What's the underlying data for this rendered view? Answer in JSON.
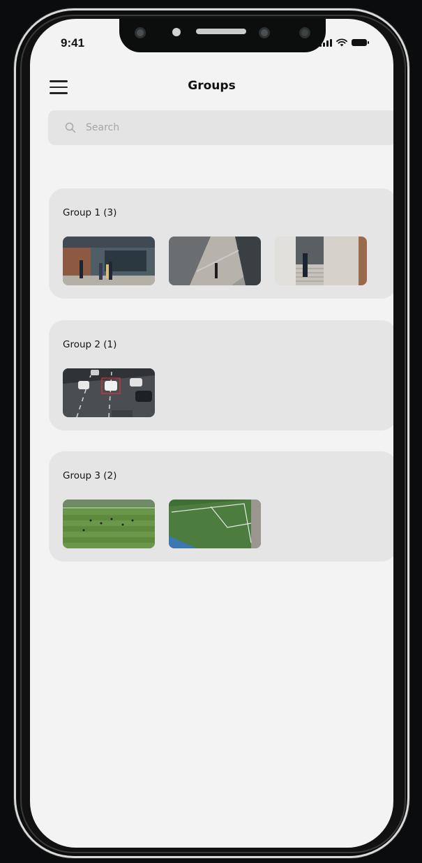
{
  "status_bar": {
    "time": "9:41"
  },
  "header": {
    "title": "Groups"
  },
  "search": {
    "placeholder": "Search"
  },
  "groups": [
    {
      "label": "Group 1 (3)",
      "thumbnails": [
        "entrance-people",
        "building-walkway",
        "stairs-person"
      ]
    },
    {
      "label": "Group 2 (1)",
      "thumbnails": [
        "highway-traffic"
      ]
    },
    {
      "label": "Group 3 (2)",
      "thumbnails": [
        "soccer-field-aerial",
        "soccer-field-corner"
      ]
    }
  ],
  "colors": {
    "screen_bg": "#f3f3f3",
    "card_bg": "#e5e5e5",
    "search_bg": "#e4e4e4"
  }
}
